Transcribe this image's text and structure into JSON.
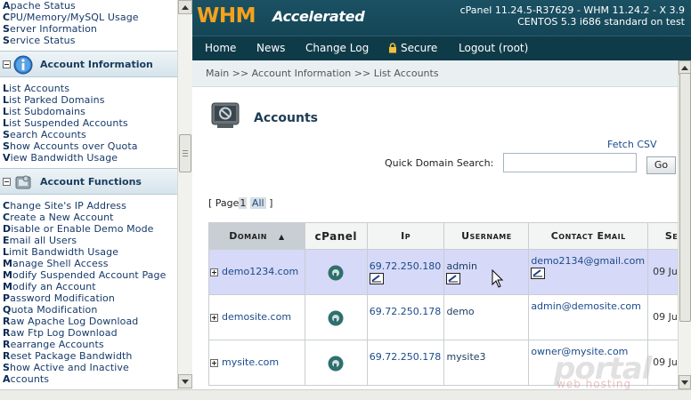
{
  "sidebar": {
    "top_links": [
      "Apache Status",
      "CPU/Memory/MySQL Usage",
      "Server Information",
      "Service Status"
    ],
    "sections": [
      {
        "title": "Account Information",
        "links": [
          "List Accounts",
          "List Parked Domains",
          "List Subdomains",
          "List Suspended Accounts",
          "Search Accounts",
          "Show Accounts over Quota",
          "View Bandwidth Usage"
        ]
      },
      {
        "title": "Account Functions",
        "links": [
          "Change Site's IP Address",
          "Create a New Account",
          "Disable or Enable Demo Mode",
          "Email all Users",
          "Limit Bandwidth Usage",
          "Manage Shell Access",
          "Modify Suspended Account Page",
          "Modify an Account",
          "Password Modification",
          "Quota Modification",
          "Raw Apache Log Download",
          "Raw Ftp Log Download",
          "Rearrange Accounts",
          "Reset Package Bandwidth",
          "Show Active and Inactive",
          "Accounts"
        ]
      }
    ]
  },
  "header": {
    "logo_main": "WHM",
    "logo_sub": "Accelerated",
    "version_line1": "cPanel 11.24.5-R37629 - WHM 11.24.2 - X 3.9",
    "version_line2": "CENTOS 5.3 i686 standard on test",
    "brand_color": "#f6a21c"
  },
  "nav": {
    "items": [
      "Home",
      "News",
      "Change Log",
      "Secure",
      "Logout (root)"
    ]
  },
  "breadcrumb": "Main >> Account Information >> List Accounts",
  "page": {
    "title": "Accounts",
    "fetch_csv": "Fetch CSV",
    "search_label": "Quick Domain Search:",
    "search_value": "",
    "go_label": "Go",
    "pager_prefix": "[ Page",
    "pager_current": "1",
    "pager_all": "All",
    "pager_suffix": "]"
  },
  "table": {
    "headers": [
      "Domain",
      "cPanel",
      "Ip",
      "Username",
      "Contact Email",
      "Setu"
    ],
    "sort_indicator": "▲",
    "rows": [
      {
        "domain": "demo1234.com",
        "ip": "69.72.250.180",
        "username": "admin",
        "email": "demo2134@gmail.com",
        "setup": "09 Ju",
        "highlighted": true
      },
      {
        "domain": "demosite.com",
        "ip": "69.72.250.178",
        "username": "demo",
        "email": "admin@demosite.com",
        "setup": "09 Ju",
        "highlighted": false
      },
      {
        "domain": "mysite.com",
        "ip": "69.72.250.178",
        "username": "mysite3",
        "email": "owner@mysite.com",
        "setup": "09 Ju",
        "highlighted": false
      }
    ]
  },
  "watermark": {
    "main": "portal",
    "sub": "web hosting"
  }
}
